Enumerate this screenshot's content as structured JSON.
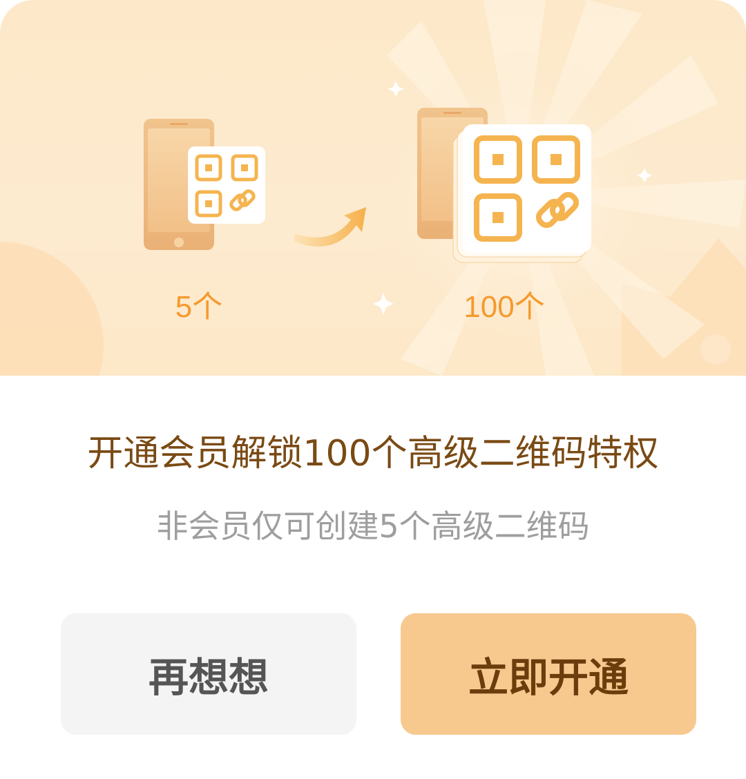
{
  "banner": {
    "count_before": "5个",
    "count_after": "100个"
  },
  "content": {
    "title": "开通会员解锁100个高级二维码特权",
    "subtitle": "非会员仅可创建5个高级二维码"
  },
  "actions": {
    "cancel_label": "再想想",
    "confirm_label": "立即开通"
  },
  "colors": {
    "banner_bg": "#fde9c9",
    "accent_orange": "#f49a2e",
    "title_brown": "#7a4a14",
    "confirm_bg": "#f7c98f",
    "cancel_bg": "#f4f4f4"
  },
  "icons": [
    "phone-icon",
    "qr-code-icon",
    "arrow-icon",
    "sparkle-icon"
  ]
}
